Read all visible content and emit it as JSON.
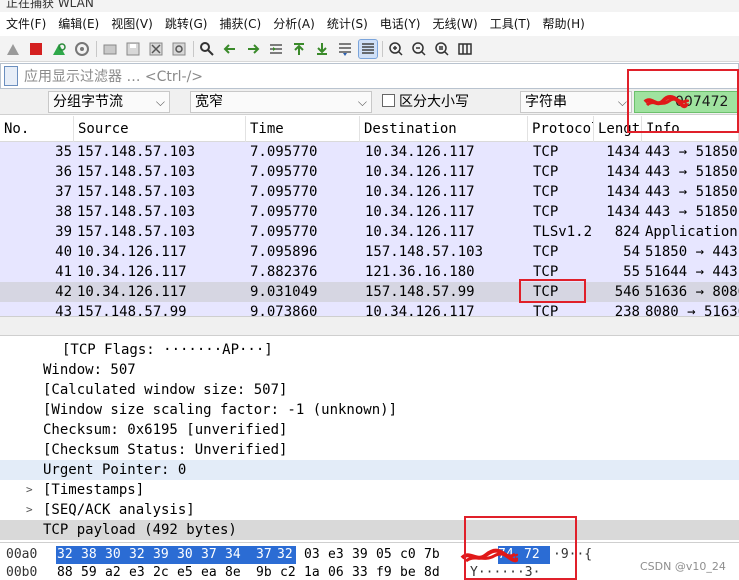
{
  "window": {
    "title": "正在捕获 WLAN"
  },
  "menu": [
    "文件(F)",
    "编辑(E)",
    "视图(V)",
    "跳转(G)",
    "捕获(C)",
    "分析(A)",
    "统计(S)",
    "电话(Y)",
    "无线(W)",
    "工具(T)",
    "帮助(H)"
  ],
  "filter": {
    "placeholder": "应用显示过滤器 … <Ctrl-/>"
  },
  "find": {
    "search_in": "分组字节流",
    "char_width": "宽窄",
    "case_label": "区分大小写",
    "search_type": "字符串",
    "value": "007472"
  },
  "columns": [
    "No.",
    "Source",
    "Time",
    "Destination",
    "Protocol",
    "Length",
    "Info"
  ],
  "packets": [
    {
      "no": "35",
      "source": "157.148.57.103",
      "time": "7.095770",
      "destination": "10.34.126.117",
      "protocol": "TCP",
      "length": "1434",
      "info": "443 → 51850"
    },
    {
      "no": "36",
      "source": "157.148.57.103",
      "time": "7.095770",
      "destination": "10.34.126.117",
      "protocol": "TCP",
      "length": "1434",
      "info": "443 → 51850"
    },
    {
      "no": "37",
      "source": "157.148.57.103",
      "time": "7.095770",
      "destination": "10.34.126.117",
      "protocol": "TCP",
      "length": "1434",
      "info": "443 → 51850"
    },
    {
      "no": "38",
      "source": "157.148.57.103",
      "time": "7.095770",
      "destination": "10.34.126.117",
      "protocol": "TCP",
      "length": "1434",
      "info": "443 → 51850"
    },
    {
      "no": "39",
      "source": "157.148.57.103",
      "time": "7.095770",
      "destination": "10.34.126.117",
      "protocol": "TLSv1.2",
      "length": "824",
      "info": "Application"
    },
    {
      "no": "40",
      "source": "10.34.126.117",
      "time": "7.095896",
      "destination": "157.148.57.103",
      "protocol": "TCP",
      "length": "54",
      "info": "51850 → 443"
    },
    {
      "no": "41",
      "source": "10.34.126.117",
      "time": "7.882376",
      "destination": "121.36.16.180",
      "protocol": "TCP",
      "length": "55",
      "info": "51644 → 443"
    },
    {
      "no": "42",
      "source": "10.34.126.117",
      "time": "9.031049",
      "destination": "157.148.57.99",
      "protocol": "TCP",
      "length": "546",
      "info": "51636 → 8080"
    },
    {
      "no": "43",
      "source": "157.148.57.99",
      "time": "9.073860",
      "destination": "10.34.126.117",
      "protocol": "TCP",
      "length": "238",
      "info": "8080 → 51636"
    }
  ],
  "details": [
    {
      "text": "[TCP Flags: ·······AP···]",
      "arrow": ""
    },
    {
      "text": "Window: 507",
      "arrow": ""
    },
    {
      "text": "[Calculated window size: 507]",
      "arrow": ""
    },
    {
      "text": "[Window size scaling factor: -1 (unknown)]",
      "arrow": ""
    },
    {
      "text": "Checksum: 0x6195 [unverified]",
      "arrow": ""
    },
    {
      "text": "[Checksum Status: Unverified]",
      "arrow": ""
    },
    {
      "text": "Urgent Pointer: 0",
      "arrow": ""
    },
    {
      "text": "[Timestamps]",
      "arrow": ">"
    },
    {
      "text": "[SEQ/ACK analysis]",
      "arrow": ">"
    },
    {
      "text": "TCP payload (492 bytes)",
      "arrow": ""
    }
  ],
  "hex": [
    {
      "offset": "00a0",
      "bytes": [
        "32",
        "38",
        "30",
        "32",
        "39",
        "30",
        "37",
        "34",
        "37",
        "32",
        "03",
        "e3",
        "39",
        "05",
        "c0",
        "7b",
        "",
        "",
        "74",
        "72"
      ],
      "ascii": "·9··{"
    },
    {
      "offset": "00b0",
      "bytes": [
        "88",
        "59",
        "a2",
        "e3",
        "2c",
        "e5",
        "ea",
        "8e",
        "9b",
        "c2",
        "1a",
        "06",
        "33",
        "f9",
        "be",
        "8d",
        "",
        "",
        "",
        ""
      ],
      "ascii": "Y······3·"
    }
  ],
  "watermark": "CSDN @v10_24",
  "colors": {
    "row_tcp": "#e7e6ff",
    "row_selected": "#d6d6e2",
    "find_match": "#9fe29f",
    "annotation_box": "#e0202a",
    "hex_selection": "#2b6cd4"
  }
}
